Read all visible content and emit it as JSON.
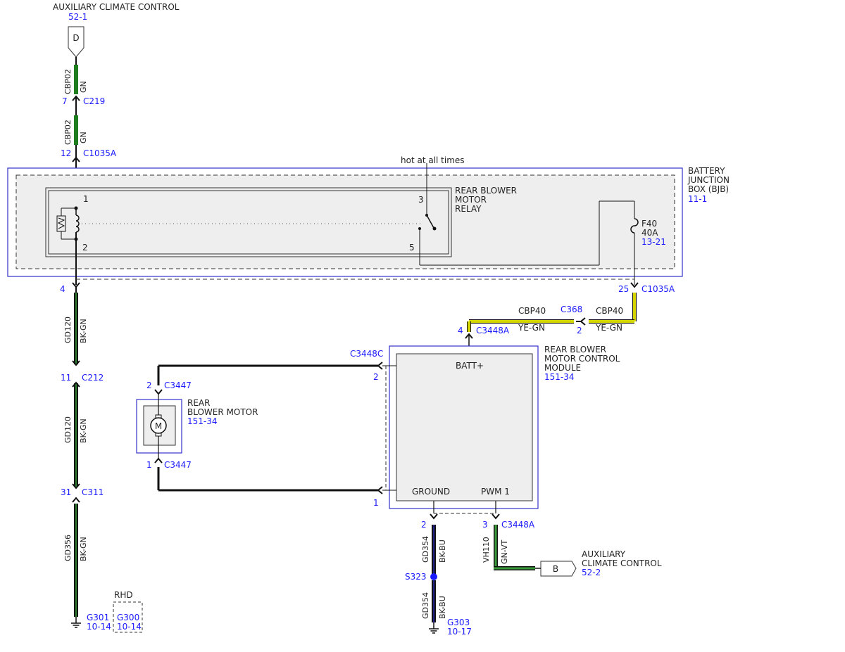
{
  "colors": {
    "blue_ref": "#1a1aff",
    "green_wire": "#1e7d1e",
    "black_wire": "#111111",
    "bk_gn_stripe": "#2e7d32",
    "bk_bu_stripe": "#22228a",
    "yellow_wire": "#d4d400",
    "box_fill": "#f0f0f0",
    "module_outline": "#3333cc"
  },
  "top": {
    "title": "AUXILIARY CLIMATE CONTROL",
    "ref": "52-1",
    "connector_letter": "D",
    "wire1_circuit": "CBP02",
    "wire1_color": "GN",
    "c219_pin": "7",
    "c219": "C219",
    "wire2_circuit": "CBP02",
    "wire2_color": "GN",
    "c1035a_pin": "12",
    "c1035a": "C1035A"
  },
  "bjb": {
    "title_line1": "BATTERY",
    "title_line2": "JUNCTION",
    "title_line3": "BOX (BJB)",
    "ref": "11-1",
    "hot_note": "hot at all times",
    "relay_line1": "REAR BLOWER",
    "relay_line2": "MOTOR",
    "relay_line3": "RELAY",
    "relay_pin1": "1",
    "relay_pin2": "2",
    "relay_pin3": "3",
    "relay_pin5": "5",
    "fuse_name": "F40",
    "fuse_rating": "40A",
    "fuse_ref": "13-21",
    "out_pin_left": "4",
    "out_pin_right": "25",
    "out_connector_right": "C1035A"
  },
  "ground_chain": {
    "wire1_circuit": "GD120",
    "wire1_color": "BK-GN",
    "c212_pin": "11",
    "c212": "C212",
    "wire2_circuit": "GD120",
    "wire2_color": "BK-GN",
    "c311_pin": "31",
    "c311": "C311",
    "wire3_circuit": "GD356",
    "wire3_color": "BK-GN",
    "g301": "G301",
    "g301_ref": "10-14",
    "rhd": "RHD",
    "g300": "G300",
    "g300_ref": "10-14"
  },
  "feed": {
    "wire_a_circuit": "CBP40",
    "wire_a_color": "YE-GN",
    "c368": "C368",
    "c368_pin": "2",
    "wire_b_circuit": "CBP40",
    "wire_b_color": "YE-GN",
    "c3448a_pin": "4",
    "c3448a": "C3448A"
  },
  "module": {
    "line1": "REAR BLOWER",
    "line2": "MOTOR CONTROL",
    "line3": "MODULE",
    "ref": "151-34",
    "batt_label": "BATT+",
    "ground_label": "GROUND",
    "pwm_label": "PWM 1",
    "c3448c": "C3448C",
    "c3448c_pin2": "2",
    "c3448c_pin1": "1"
  },
  "motor": {
    "line1": "REAR",
    "line2": "BLOWER MOTOR",
    "ref": "151-34",
    "symbol": "M",
    "pin_top": "2",
    "conn_top": "C3447",
    "pin_bottom": "1",
    "conn_bottom": "C3447"
  },
  "module_ground": {
    "pin": "2",
    "wire1_circuit": "GD354",
    "wire1_color": "BK-BU",
    "splice": "S323",
    "wire2_circuit": "GD354",
    "wire2_color": "BK-BU",
    "ground": "G303",
    "ground_ref": "10-17"
  },
  "pwm_out": {
    "pin": "3",
    "connector": "C3448A",
    "circuit": "VH110",
    "color": "GN-VT",
    "connector_letter": "B",
    "dest_line1": "AUXILIARY",
    "dest_line2": "CLIMATE CONTROL",
    "dest_ref": "52-2"
  }
}
